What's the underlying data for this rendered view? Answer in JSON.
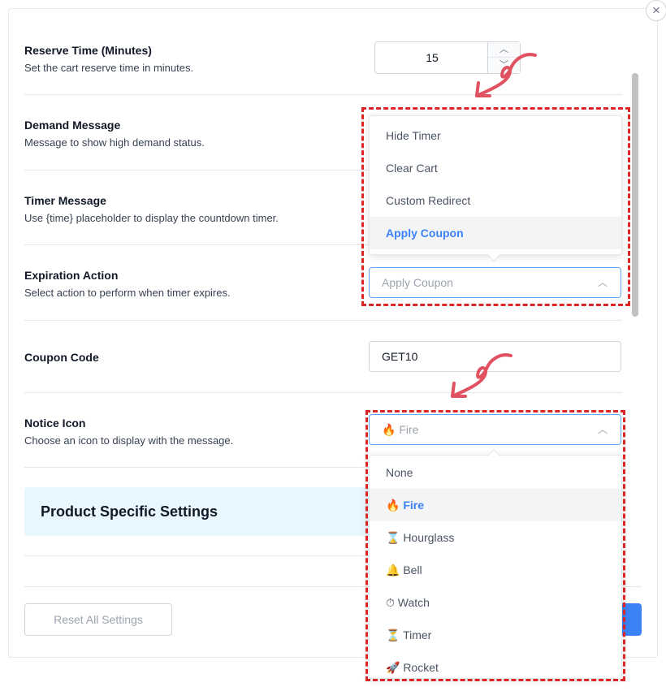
{
  "close_label": "×",
  "reserve_time": {
    "title": "Reserve Time (Minutes)",
    "desc": "Set the cart reserve time in minutes.",
    "value": "15"
  },
  "demand_message": {
    "title": "Demand Message",
    "desc": "Message to show high demand status."
  },
  "timer_message": {
    "title": "Timer Message",
    "desc": "Use {time} placeholder to display the countdown timer."
  },
  "expiration_action": {
    "title": "Expiration Action",
    "desc": "Select action to perform when timer expires.",
    "selected": "Apply Coupon",
    "options": [
      "Hide Timer",
      "Clear Cart",
      "Custom Redirect",
      "Apply Coupon"
    ]
  },
  "coupon_code": {
    "title": "Coupon Code",
    "value": "GET10"
  },
  "notice_icon": {
    "title": "Notice Icon",
    "desc": "Choose an icon to display with the message.",
    "selected": "🔥 Fire",
    "options": [
      "None",
      "🔥 Fire",
      "⌛ Hourglass",
      "🔔 Bell",
      "⏱ Watch",
      "⏳ Timer",
      "🚀 Rocket"
    ]
  },
  "section": {
    "title": "Product Specific Settings"
  },
  "footer": {
    "reset_label": "Reset All Settings"
  },
  "colors": {
    "accent": "#3b82f6",
    "highlight_border": "#dc2626",
    "annotation_arrow": "#e05260"
  }
}
